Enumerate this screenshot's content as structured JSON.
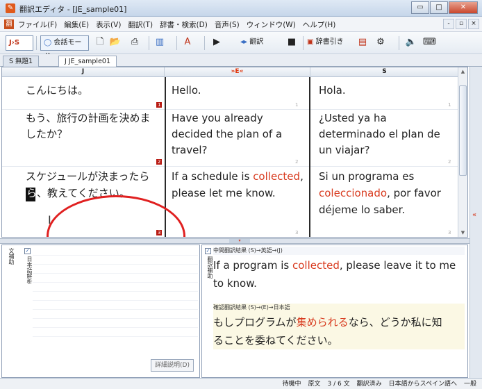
{
  "window": {
    "title": "翻訳エディタ - [JE_sample01]",
    "controls": [
      "▭",
      "□",
      "✕"
    ]
  },
  "menubar": {
    "items": [
      "ファイル(F)",
      "編集(E)",
      "表示(V)",
      "翻訳(T)",
      "辞書・検索(D)",
      "音声(S)",
      "ウィンドウ(W)",
      "ヘルプ(H)"
    ],
    "right_controls": [
      "-",
      "▫",
      "×"
    ]
  },
  "toolbar": {
    "lang_selector": "J›S",
    "conversation_mode": "会話モード",
    "translate_label": "翻訳",
    "dictionary_label": "辞書引き",
    "icons": [
      "new-document-icon",
      "open-folder-icon",
      "print-icon",
      "columns-icon",
      "font-icon",
      "play-icon",
      "translate-icon",
      "stop-icon",
      "dictionary-icon",
      "settings-icon",
      "speaker-icon",
      "keyboard-icon"
    ]
  },
  "tabs": [
    {
      "label": "S 無題1",
      "active": false
    },
    {
      "label": "J JE_sample01",
      "active": true
    }
  ],
  "columns": {
    "left_header": "J",
    "mid_header": "»E«",
    "right_header": "S"
  },
  "segments": {
    "ja": [
      "こんにちは。",
      "もう、旅行の計画を決めま",
      "したか？",
      "スケジュールが決まったら",
      "ら",
      "、教えてください。"
    ],
    "en": [
      "Hello.",
      "Have you already",
      "decided the plan of a",
      "travel?",
      "If a schedule is ",
      "collected",
      ",",
      "please let me know."
    ],
    "es": [
      "Hola.",
      "¿Usted ya ha",
      "determinado el plan de",
      "un viajar?",
      "Si un programa es",
      "coleccionado",
      ", por favor",
      "déjeme lo saber."
    ],
    "markers": [
      "1",
      "2",
      "3"
    ]
  },
  "lower_left": {
    "label": "日本語解析",
    "side_label": "文補助",
    "detail_button": "詳細説明(D)"
  },
  "lower_right": {
    "side_label": "翻訳補助",
    "intermediate_header": "中間翻訳結果 (S)→英語→(J)",
    "intermediate_pre": "If a program is ",
    "intermediate_red": "collected",
    "intermediate_post": ", please leave it to me",
    "intermediate_line2": "to know.",
    "back_header": "確認翻訳結果 (S)→(E)→日本語",
    "back_pre": "もしプログラムが",
    "back_red": "集められる",
    "back_post": "なら、どうか私に知",
    "back_line2": "ることを委ねてください。"
  },
  "statusbar": {
    "state": "待機中",
    "source": "原文",
    "sentence": "3 / 6 文",
    "translated": "翻訳済み",
    "direction": "日本語からスペイン語へ",
    "mode": "一般"
  },
  "colors": {
    "accent_red": "#d83a1e",
    "marker_red": "#b81a12",
    "highlight_circle": "#e02020"
  }
}
